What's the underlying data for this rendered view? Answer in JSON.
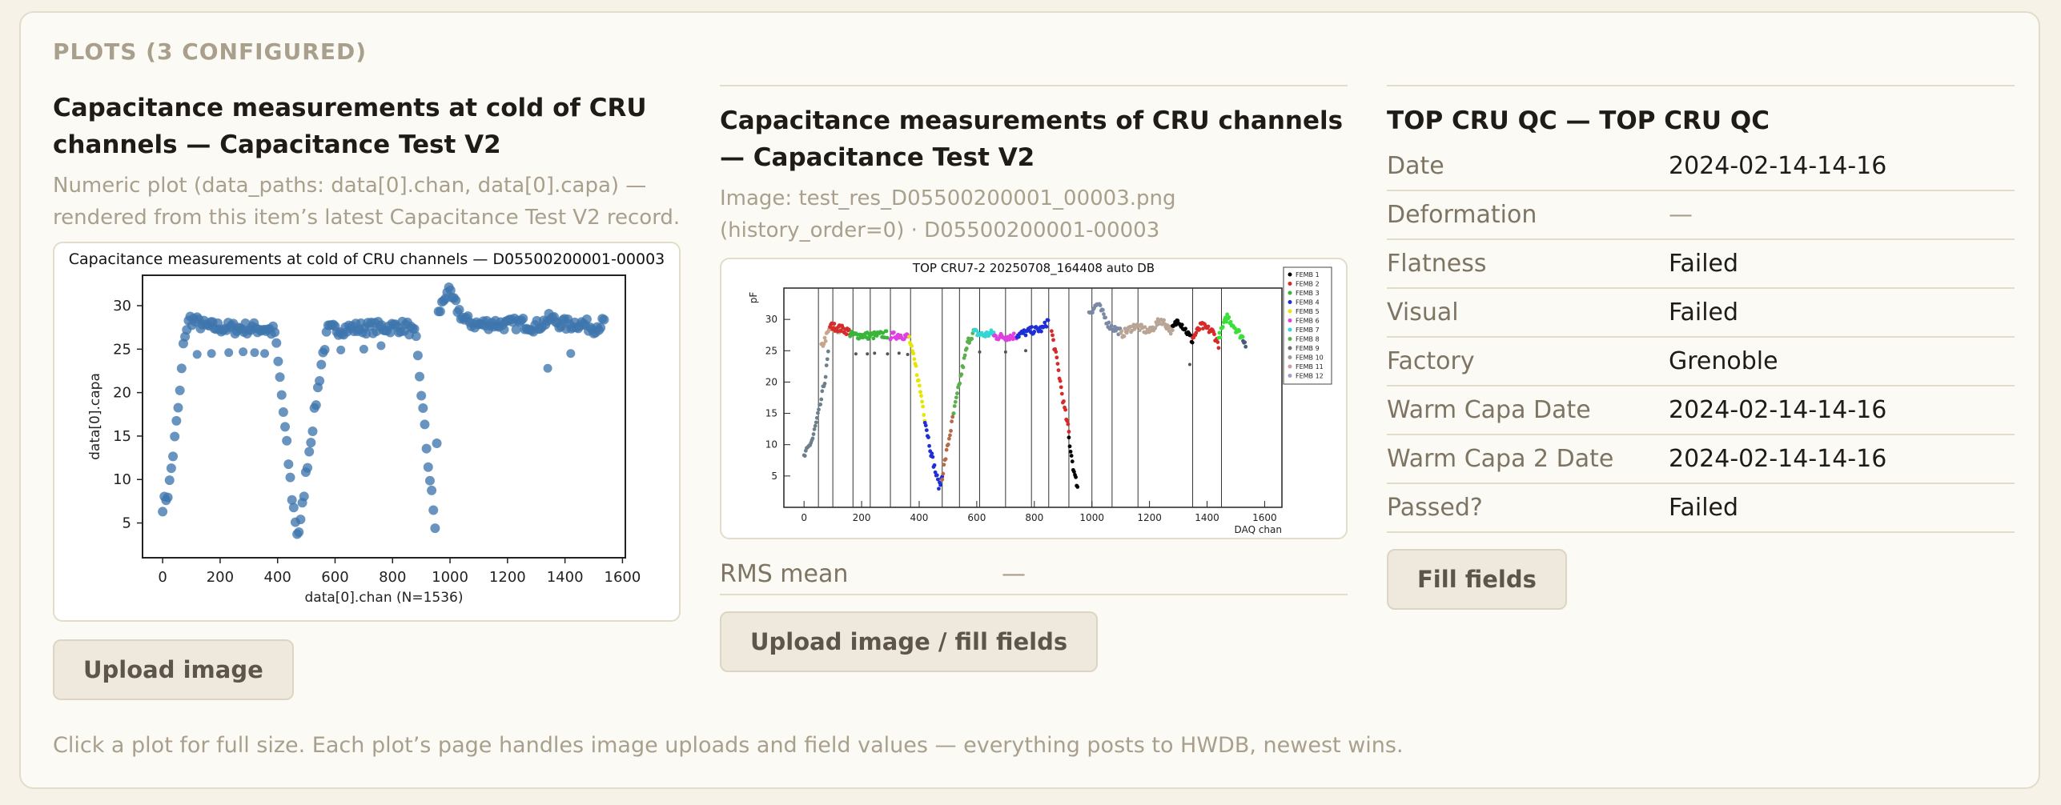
{
  "section": {
    "label": "PLOTS (3 CONFIGURED)"
  },
  "plots": [
    {
      "title": "Capacitance measurements at cold of CRU channels — Capacitance Test V2",
      "description": "Numeric plot (data_paths: data[0].chan, data[0].capa) — rendered from this item’s latest Capacitance Test V2 record.",
      "button": "Upload image"
    },
    {
      "title": "Capacitance measurements of CRU channels — Capacitance Test V2",
      "description": "Image: test_res_D05500200001_00003.png (history_order=0) · D05500200001-00003",
      "fields": [
        {
          "label": "RMS mean",
          "value": "—"
        }
      ],
      "button": "Upload image / fill fields"
    },
    {
      "title": "TOP CRU QC — TOP CRU QC",
      "fields": [
        {
          "label": "Date",
          "value": "2024-02-14-14-16"
        },
        {
          "label": "Deformation",
          "value": "—"
        },
        {
          "label": "Flatness",
          "value": "Failed"
        },
        {
          "label": "Visual",
          "value": "Failed"
        },
        {
          "label": "Factory",
          "value": "Grenoble"
        },
        {
          "label": "Warm Capa Date",
          "value": "2024-02-14-14-16"
        },
        {
          "label": "Warm Capa 2 Date",
          "value": "2024-02-14-14-16"
        },
        {
          "label": "Passed?",
          "value": "Failed"
        }
      ],
      "button": "Fill fields"
    }
  ],
  "footer": "Click a plot for full size. Each plot’s page handles image uploads and field values — everything posts to HWDB, newest wins.",
  "chart_data": [
    {
      "type": "scatter",
      "title": "Capacitance measurements at cold of CRU channels — D05500200001-00003",
      "xlabel": "data[0].chan  (N=1536)",
      "ylabel": "data[0].capa",
      "xlim": [
        -70,
        1610
      ],
      "ylim": [
        1,
        33.5
      ],
      "xticks": [
        0,
        200,
        400,
        600,
        800,
        1000,
        1200,
        1400,
        1600
      ],
      "yticks": [
        5,
        10,
        15,
        20,
        25,
        30
      ],
      "point_color": "#3d76ad",
      "profile": [
        [
          0,
          7
        ],
        [
          20,
          8.5
        ],
        [
          40,
          14
        ],
        [
          60,
          20
        ],
        [
          75,
          26.5
        ],
        [
          95,
          28.5
        ],
        [
          150,
          27.6
        ],
        [
          250,
          27.4
        ],
        [
          350,
          27.4
        ],
        [
          390,
          27
        ],
        [
          410,
          21
        ],
        [
          430,
          14.5
        ],
        [
          450,
          8
        ],
        [
          470,
          3.5
        ],
        [
          480,
          5
        ],
        [
          500,
          11
        ],
        [
          530,
          18
        ],
        [
          555,
          24
        ],
        [
          575,
          27.2
        ],
        [
          650,
          27.4
        ],
        [
          750,
          27.5
        ],
        [
          850,
          27.6
        ],
        [
          880,
          26.5
        ],
        [
          900,
          20
        ],
        [
          920,
          13
        ],
        [
          940,
          7
        ],
        [
          950,
          4
        ],
        [
          960,
          29
        ],
        [
          990,
          31.8
        ],
        [
          1010,
          30.6
        ],
        [
          1050,
          28.3
        ],
        [
          1100,
          27.8
        ],
        [
          1150,
          28
        ],
        [
          1200,
          27.8
        ],
        [
          1250,
          28
        ],
        [
          1300,
          27.6
        ],
        [
          1350,
          28.5
        ],
        [
          1400,
          27.8
        ],
        [
          1450,
          28
        ],
        [
          1500,
          27.5
        ],
        [
          1536,
          28
        ]
      ],
      "outliers": [
        [
          120,
          24.4
        ],
        [
          170,
          24.5
        ],
        [
          230,
          24.6
        ],
        [
          280,
          24.7
        ],
        [
          320,
          24.6
        ],
        [
          355,
          24.5
        ],
        [
          620,
          24.9
        ],
        [
          700,
          25
        ],
        [
          760,
          25.4
        ],
        [
          1340,
          22.8
        ],
        [
          1420,
          24.5
        ]
      ]
    },
    {
      "type": "scatter",
      "title": "TOP CRU7-2 20250708_164408 auto DB",
      "xlabel": "DAQ chan",
      "ylabel": "pF",
      "xlim": [
        -70,
        1660
      ],
      "ylim": [
        0,
        35
      ],
      "xticks": [
        0,
        200,
        400,
        600,
        800,
        1000,
        1200,
        1400,
        1600
      ],
      "yticks": [
        5,
        10,
        15,
        20,
        25,
        30
      ],
      "divider_channels": [
        50,
        100,
        170,
        230,
        300,
        370,
        480,
        540,
        610,
        700,
        790,
        850,
        920,
        1000,
        1070,
        1160,
        1350,
        1450
      ],
      "legend": [
        "FEMB 1",
        "FEMB 2",
        "FEMB 3",
        "FEMB 4",
        "FEMB 5",
        "FEMB 6",
        "FEMB 7",
        "FEMB 8",
        "FEMB 9",
        "FEMB 10",
        "FEMB 11",
        "FEMB 12"
      ],
      "legend_colors": [
        "#000000",
        "#d62b2b",
        "#39b539",
        "#1f2fd6",
        "#e6e600",
        "#e040e0",
        "#35d6d6",
        "#5ab04a",
        "#707070",
        "#9a9a9a",
        "#c9a0a0",
        "#a0a0c9"
      ],
      "segments": [
        {
          "color": "#6e7f8c",
          "points": [
            [
              0,
              8
            ],
            [
              30,
              11
            ],
            [
              55,
              16
            ],
            [
              75,
              21
            ],
            [
              85,
              25
            ]
          ]
        },
        {
          "color": "#c9a58b",
          "points": [
            [
              60,
              25.5
            ],
            [
              90,
              28.5
            ],
            [
              130,
              28.2
            ]
          ]
        },
        {
          "color": "#d62b2b",
          "points": [
            [
              90,
              29
            ],
            [
              130,
              28.5
            ],
            [
              160,
              28
            ]
          ]
        },
        {
          "color": "#39b539",
          "points": [
            [
              160,
              27.5
            ],
            [
              230,
              27.4
            ],
            [
              290,
              27.6
            ]
          ]
        },
        {
          "color": "#e040e0",
          "points": [
            [
              300,
              27.3
            ],
            [
              330,
              27.5
            ],
            [
              365,
              27.2
            ]
          ]
        },
        {
          "color": "#e6e600",
          "points": [
            [
              365,
              27
            ],
            [
              390,
              22
            ],
            [
              410,
              17
            ],
            [
              420,
              14
            ]
          ]
        },
        {
          "color": "#1f2fd6",
          "points": [
            [
              420,
              14
            ],
            [
              440,
              9
            ],
            [
              460,
              5
            ],
            [
              470,
              3.2
            ],
            [
              480,
              5
            ]
          ]
        },
        {
          "color": "#b8694a",
          "points": [
            [
              480,
              5
            ],
            [
              500,
              10
            ],
            [
              520,
              15
            ]
          ]
        },
        {
          "color": "#5ab04a",
          "points": [
            [
              520,
              15
            ],
            [
              545,
              21
            ],
            [
              570,
              26.5
            ],
            [
              590,
              28
            ]
          ]
        },
        {
          "color": "#35d6d6",
          "points": [
            [
              590,
              28
            ],
            [
              620,
              27.5
            ],
            [
              660,
              27.8
            ]
          ]
        },
        {
          "color": "#e040e0",
          "points": [
            [
              660,
              27.3
            ],
            [
              700,
              27.2
            ],
            [
              740,
              27.4
            ]
          ]
        },
        {
          "color": "#1f2fd6",
          "points": [
            [
              740,
              27.5
            ],
            [
              790,
              28.2
            ],
            [
              830,
              28.5
            ],
            [
              850,
              30
            ]
          ]
        },
        {
          "color": "#d62b2b",
          "points": [
            [
              860,
              28
            ],
            [
              880,
              23
            ],
            [
              900,
              17
            ],
            [
              920,
              12
            ]
          ]
        },
        {
          "color": "#000000",
          "points": [
            [
              920,
              11
            ],
            [
              930,
              8
            ],
            [
              940,
              5
            ],
            [
              950,
              3.5
            ]
          ]
        },
        {
          "color": "#7a8aa5",
          "points": [
            [
              990,
              31
            ],
            [
              1020,
              32.5
            ],
            [
              1060,
              29
            ],
            [
              1100,
              28
            ]
          ]
        },
        {
          "color": "#b8a595",
          "points": [
            [
              1100,
              27.5
            ],
            [
              1150,
              29
            ],
            [
              1200,
              28
            ],
            [
              1240,
              30
            ],
            [
              1280,
              28
            ]
          ]
        },
        {
          "color": "#000000",
          "points": [
            [
              1280,
              28.5
            ],
            [
              1300,
              30
            ],
            [
              1330,
              28
            ],
            [
              1350,
              26.5
            ]
          ]
        },
        {
          "color": "#d62b2b",
          "points": [
            [
              1350,
              27
            ],
            [
              1380,
              29
            ],
            [
              1420,
              28
            ],
            [
              1440,
              26
            ]
          ]
        },
        {
          "color": "#39e039",
          "points": [
            [
              1440,
              27
            ],
            [
              1470,
              30.5
            ],
            [
              1500,
              28.5
            ],
            [
              1525,
              27
            ]
          ]
        },
        {
          "color": "#4a5a7a",
          "points": [
            [
              1525,
              27
            ],
            [
              1536,
              26
            ]
          ]
        }
      ],
      "outliers": [
        [
          180,
          24.5
        ],
        [
          220,
          24.5
        ],
        [
          245,
          24.6
        ],
        [
          290,
          24.5
        ],
        [
          330,
          24.6
        ],
        [
          360,
          24.4
        ],
        [
          610,
          24.8
        ],
        [
          700,
          24.8
        ],
        [
          770,
          25
        ],
        [
          1340,
          22.8
        ]
      ]
    }
  ]
}
